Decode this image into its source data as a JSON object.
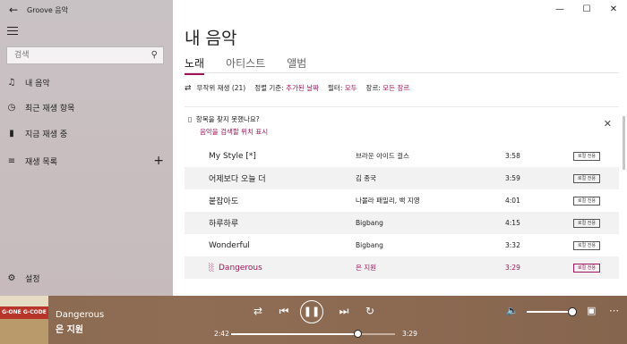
{
  "app": {
    "title": "Groove 음악"
  },
  "sidebar": {
    "search_placeholder": "검색",
    "items": [
      {
        "label": "내 음악",
        "icon": "music-note-icon"
      },
      {
        "label": "최근 재생 항목",
        "icon": "clock-icon"
      },
      {
        "label": "지금 재생 중",
        "icon": "bars-icon"
      },
      {
        "label": "재생 목록",
        "icon": "list-icon"
      }
    ],
    "settings_label": "설정"
  },
  "main": {
    "title": "내 음악",
    "tabs": [
      "노래",
      "아티스트",
      "앨범"
    ],
    "active_tab": "노래",
    "toolbar": {
      "shuffle_label": "무작위 재생 (21)",
      "sort_label": "정렬 기준:",
      "sort_value": "추가된 날짜",
      "filter_label": "필터:",
      "filter_value": "모두",
      "genre_label": "장르:",
      "genre_value": "모든 장르"
    },
    "notice": {
      "question": "항목을 찾지 못했나요?",
      "link": "음악을 검색할 위치 표시"
    },
    "tracks": [
      {
        "title": "My Style [*]",
        "artist": "브라운 아이드 걸스",
        "duration": "3:58",
        "tag": "로컬 전용"
      },
      {
        "title": "어제보다 오늘 더",
        "artist": "김 종국",
        "duration": "3:59",
        "tag": "로컬 전용"
      },
      {
        "title": "붙잡아도",
        "artist": "나몰라 패밀리, 백 지영",
        "duration": "4:01",
        "tag": "로컬 전용"
      },
      {
        "title": "하루하루",
        "artist": "Bigbang",
        "duration": "4:15",
        "tag": "로컬 전용"
      },
      {
        "title": "Wonderful",
        "artist": "Bigbang",
        "duration": "3:32",
        "tag": "로컬 전용"
      },
      {
        "title": "Dangerous",
        "artist": "은 지원",
        "duration": "3:29",
        "tag": "로컬 전용"
      }
    ]
  },
  "player": {
    "now_playing_title": "Dangerous",
    "now_playing_artist": "은 지원",
    "elapsed": "2:42",
    "total": "3:29",
    "progress": 0.775,
    "volume": 1.0,
    "album_art_text": "G-ONE G-CODE"
  },
  "colors": {
    "accent": "#a0155a",
    "player_bg": "#8c6b53"
  }
}
